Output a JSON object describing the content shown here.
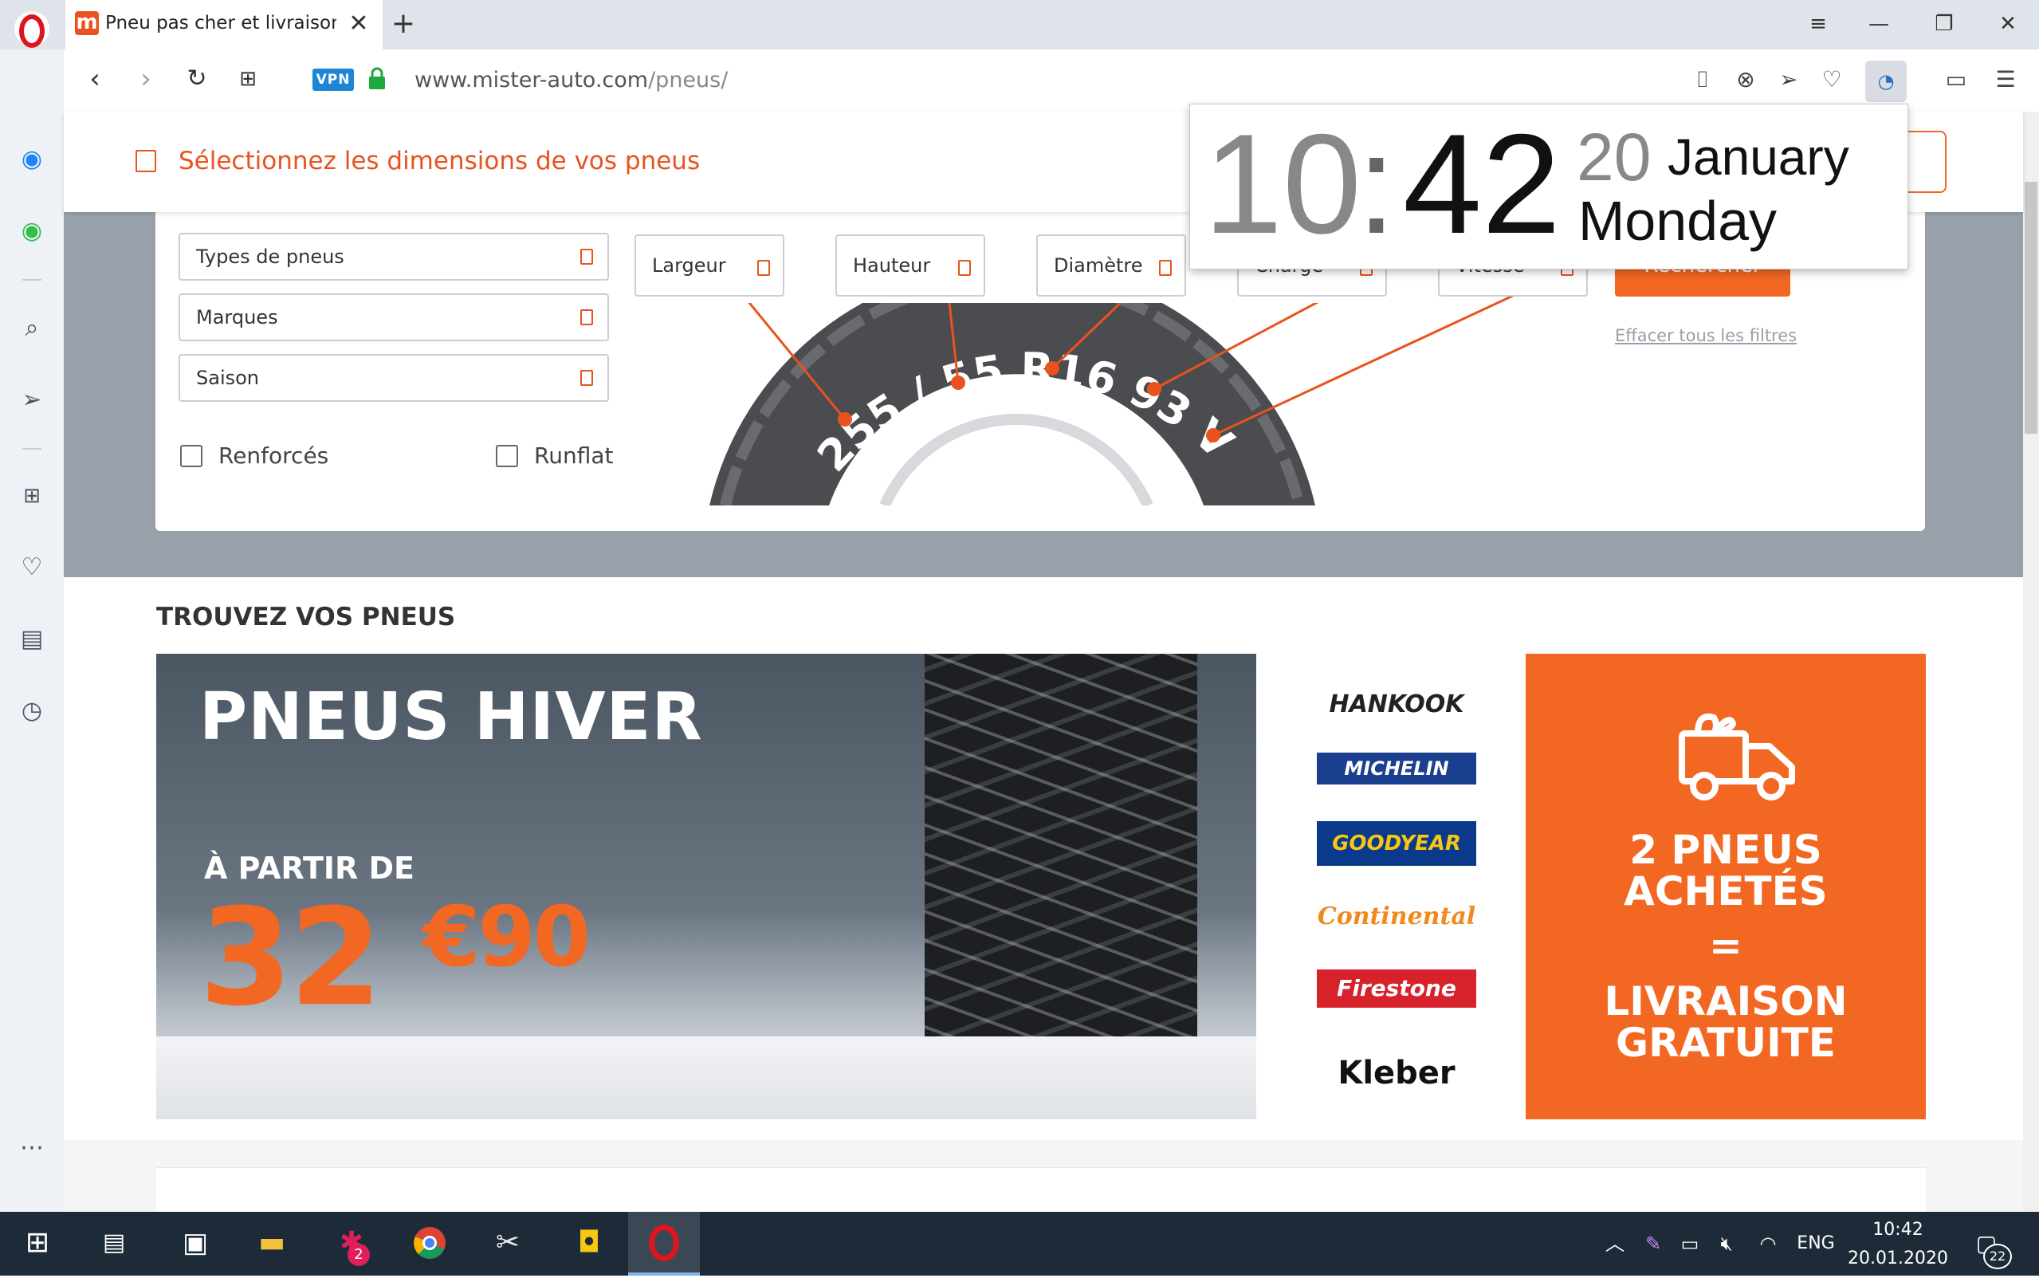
{
  "browser": {
    "tab_title": "Pneu pas cher et livraison g",
    "url_domain": "www.mister-auto.com",
    "url_path": "/pneus/",
    "vpn_label": "VPN"
  },
  "page": {
    "header_text": "Sélectionnez les dimensions de vos pneus",
    "filters": {
      "types": "Types de pneus",
      "brands": "Marques",
      "season": "Saison",
      "reinforced": "Renforcés",
      "runflat": "Runflat"
    },
    "dimensions": {
      "width": "Largeur",
      "height": "Hauteur",
      "diameter": "Diamètre",
      "load": "Charge",
      "speed": "Vitesse"
    },
    "search_button": "Rechercher",
    "clear_filters": "Effacer tous les filtres",
    "tire_code": "255 / 55 R16 93 V",
    "find_title": "TROUVEZ VOS PNEUS",
    "banner": {
      "headline": "PNEUS HIVER",
      "from": "À PARTIR DE",
      "price_main": "32",
      "price_cents": "€90",
      "brands": [
        "HANKOOK",
        "MICHELIN",
        "GOODYEAR",
        "Continental",
        "Firestone",
        "Kleber"
      ],
      "promo_line1": "2 PNEUS",
      "promo_line2": "ACHETÉS",
      "promo_eq": "=",
      "promo_line3": "LIVRAISON",
      "promo_line4": "GRATUITE"
    }
  },
  "clock_popup": {
    "hours": "10",
    "colon": ":",
    "minutes": "42",
    "day": "20",
    "month": "January",
    "weekday": "Monday"
  },
  "taskbar": {
    "time": "10:42",
    "date": "20.01.2020",
    "lang": "ENG",
    "notifications": "22",
    "slack_badge": "2"
  },
  "colors": {
    "accent": "#f26722",
    "header_orange": "#e8531f",
    "grey_band": "#98a1aa",
    "taskbar": "#1d2b38"
  }
}
